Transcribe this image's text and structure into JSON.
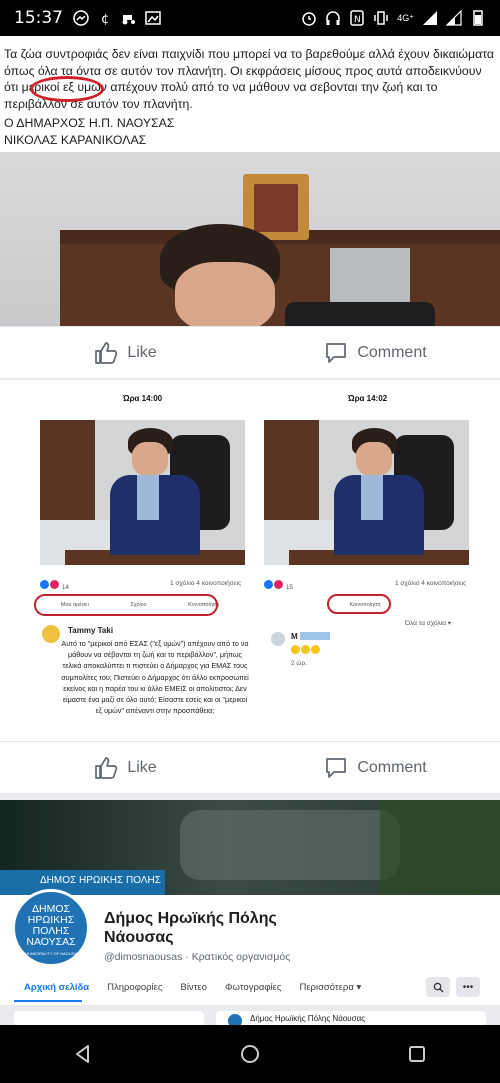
{
  "status_bar": {
    "time": "15:37",
    "network": "4G⁺"
  },
  "post1": {
    "paragraph": "Τα ζώα συντροφιάς δεν είναι παιχνίδι που μπορεί να το βαρεθούμε αλλά έχουν δικαιώματα όπως όλα τα όντα σε αυτόν τον πλανήτη. Οι εκφράσεις μίσους προς αυτά αποδεικνύουν ότι μερικοί εξ υμών απέχουν πολύ από το να μάθουν να σεβονται την ζωή και το περιβάλλον σε αυτόν τον πλανήτη.",
    "signature_line1": "Ο ΔΗΜΑΡΧΟΣ Η.Π. ΝΑΟΥΣΑΣ",
    "signature_line2": "ΝΙΚΟΛΑΣ ΚΑΡΑΝΙΚΟΛΑΣ"
  },
  "actions": {
    "like": "Like",
    "comment": "Comment"
  },
  "post2": {
    "left": {
      "time": "Ώρα 14:00",
      "reactions_count": "14",
      "stats": "1 σχόλιο 4 κοινοποιήσεις",
      "btn_like": "Μου αρέσει",
      "btn_comment": "Σχόλιο",
      "btn_share": "Κοινοποίηση",
      "commenter": "Tammy Taki",
      "comment": "Αυτό το \"μερικοί από ΕΣΑΣ (\"εξ υμών\") απέχουν από το να μάθουν να σέβονται τη ζωή και το περιβάλλον\", μήπως τελικά αποκαλύπτει τι πιστεύει ο Δήμαρχος για ΕΜΑΣ τους συμπολίτες του; Πιστεύει ο Δήμαρχος ότι άλλο εκπροσωπεί εκείνος και η παρέα του κι άλλο ΕΜΕΙΣ οι απολίτιστοι; Δεν είμαστε ένα μαζί σε όλο αυτό; Είσαστε εσείς και οι \"μερικοί εξ υμών\" απέναντι στην προσπάθεια;"
    },
    "right": {
      "time": "Ώρα 14:02",
      "reactions_count": "15",
      "stats": "1 σχόλιο 4 κοινοποιήσεις",
      "btn_share": "Κοινοποίηση",
      "all_comments": "Όλα τα σχόλια ▾",
      "commenter": "Μ",
      "time_ago": "2 ώρ."
    }
  },
  "page": {
    "cover_text": "ΔΗΜΟΣ ΗΡΩΙΚΗΣ ΠΟΛΗΣ",
    "logo_line1": "ΔΗΜΟΣ",
    "logo_line2": "ΗΡΩΙΚΗΣ",
    "logo_line3": "ΠΟΛΗΣ",
    "logo_line4": "ΝΑΟΥΣΑΣ",
    "logo_line5": "MUNICIPALITY OF NAOUSA",
    "title_line1": "Δήμος Ηρωϊκής Πόλης",
    "title_line2": "Νάουσας",
    "subtitle": "@dimosnaousas · Κρατικός οργανισμός",
    "tabs": [
      "Αρχική σελίδα",
      "Πληροφορίες",
      "Βίντεο",
      "Φωτογραφίες",
      "Περισσότερα ▾"
    ],
    "card_text": "Δήμος Ηρωϊκής Πόλης Νάουσας"
  }
}
